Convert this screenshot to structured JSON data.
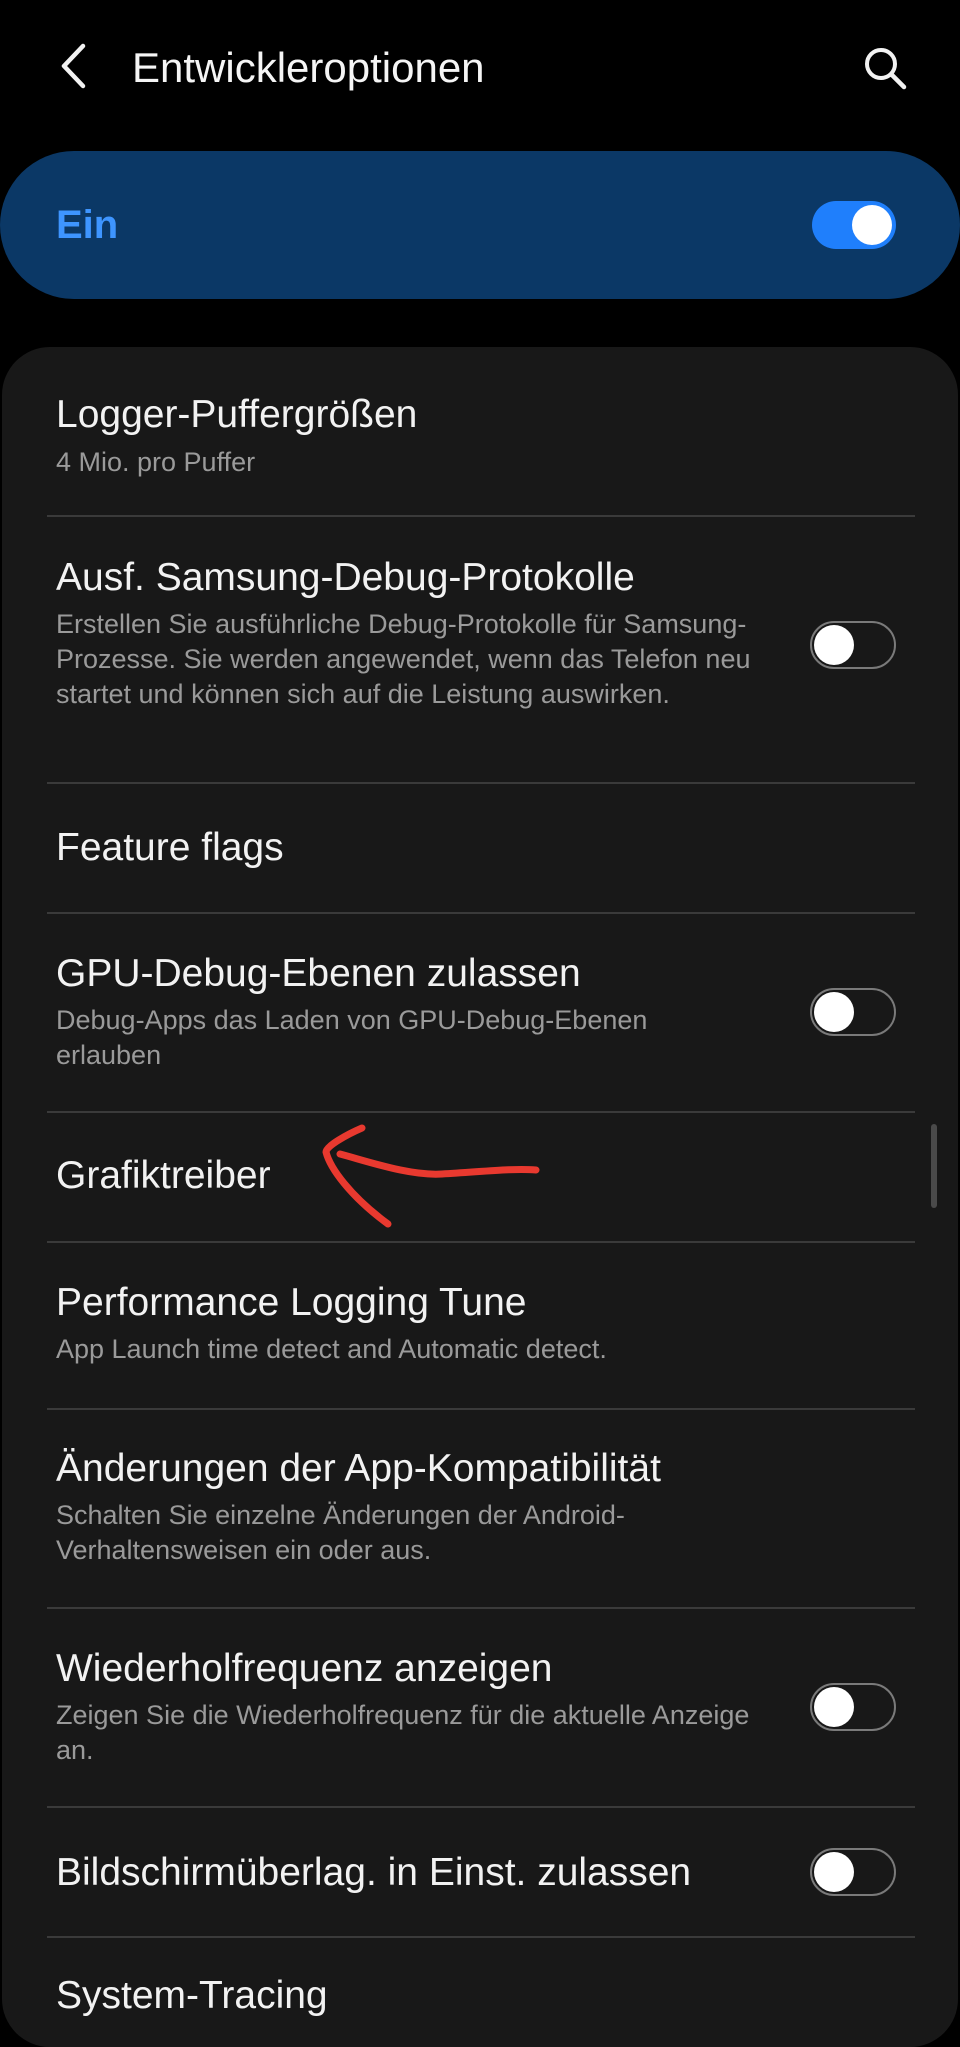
{
  "appbar": {
    "title": "Entwickleroptionen",
    "back_icon": "chevron-left-icon",
    "search_icon": "search-icon"
  },
  "master": {
    "label": "Ein",
    "enabled": true
  },
  "items": [
    {
      "title": "Logger-Puffergrößen",
      "summary": "4 Mio. pro Puffer"
    },
    {
      "title": "Ausf. Samsung-Debug-Protokolle",
      "summary": "Erstellen Sie ausführliche Debug-Protokolle für Samsung-Prozesse. Sie werden angewendet, wenn das Telefon neu startet und können sich auf die Leistung auswirken.",
      "switch_on": false
    },
    {
      "title": "Feature flags"
    },
    {
      "title": "GPU-Debug-Ebenen zulassen",
      "summary": "Debug-Apps das Laden von GPU-Debug-Ebenen erlauben",
      "switch_on": false
    },
    {
      "title": "Grafiktreiber"
    },
    {
      "title": "Performance Logging Tune",
      "summary": "App Launch time detect and Automatic detect."
    },
    {
      "title": "Änderungen der App-Kompatibilität",
      "summary": "Schalten Sie einzelne Änderungen der Android-Verhaltensweisen ein oder aus."
    },
    {
      "title": "Wiederholfrequenz anzeigen",
      "summary": "Zeigen Sie die Wiederholfrequenz für die aktuelle Anzeige an.",
      "switch_on": false
    },
    {
      "title": "Bildschirmüberlag. in Einst. zulassen",
      "switch_on": false
    },
    {
      "title": "System-Tracing"
    }
  ],
  "colors": {
    "accent": "#1f7ffc",
    "master_bg": "#0b3866",
    "annotation": "#e8392f"
  },
  "annotation_icon": "hand-drawn-arrow-icon"
}
